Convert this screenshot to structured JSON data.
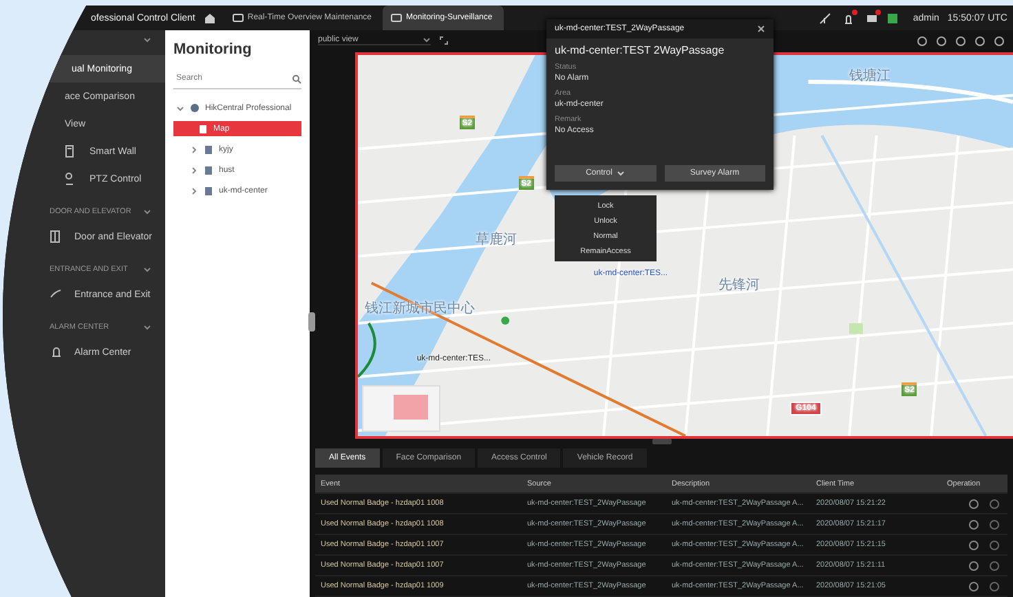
{
  "app": {
    "title": "ofessional Control Client"
  },
  "top_tabs": [
    {
      "label": "Real-Time Overview Maintenance",
      "selected": false
    },
    {
      "label": "Monitoring-Surveillance",
      "selected": true
    }
  ],
  "user": {
    "name": "admin",
    "time": "15:50:07 UTC"
  },
  "nav": [
    {
      "items": [
        {
          "label": "ual Monitoring",
          "selected": true
        },
        {
          "label": "ace Comparison",
          "selected": false
        },
        {
          "label": "View",
          "selected": false
        },
        {
          "label": "Smart Wall",
          "selected": false
        },
        {
          "label": "PTZ Control",
          "selected": false
        }
      ]
    },
    {
      "title": "DOOR AND ELEVATOR",
      "items": [
        {
          "label": "Door and Elevator",
          "selected": false
        }
      ]
    },
    {
      "title": "ENTRANCE AND EXIT",
      "items": [
        {
          "label": "Entrance and Exit",
          "selected": false
        }
      ]
    },
    {
      "title": "ALARM CENTER",
      "items": [
        {
          "label": "Alarm Center",
          "selected": false
        }
      ]
    }
  ],
  "tree": {
    "title": "Monitoring",
    "search": {
      "placeholder": "Search"
    },
    "root": {
      "label": "HikCentral Professional",
      "expanded": true,
      "children": [
        {
          "label": "Map",
          "selected": true
        },
        {
          "label": "kyjy",
          "selected": false,
          "expanded": false
        },
        {
          "label": "hust",
          "selected": false,
          "expanded": false
        },
        {
          "label": "uk-md-center",
          "selected": false,
          "expanded": false
        }
      ]
    }
  },
  "toolbar": {
    "view": "public view"
  },
  "map": {
    "labels": [
      {
        "kind": "place",
        "text": "钱塘江"
      },
      {
        "kind": "road",
        "text": "S2"
      },
      {
        "kind": "road",
        "text": "S2"
      },
      {
        "kind": "place",
        "text": "草鹿河"
      },
      {
        "kind": "marker",
        "text": "uk-md-center:TES..."
      },
      {
        "kind": "place",
        "text": "先锋河"
      },
      {
        "kind": "place",
        "text": "钱江新城市民中心"
      },
      {
        "kind": "pin",
        "text": "uk-md-center:TES..."
      },
      {
        "kind": "road",
        "text": "S2"
      },
      {
        "kind": "highway",
        "text": "G104"
      }
    ]
  },
  "popup": {
    "title": "uk-md-center:TEST_2WayPassage",
    "heading": "uk-md-center:TEST 2WayPassage",
    "fields": [
      {
        "label": "Status",
        "value": "No Alarm"
      },
      {
        "label": "Area",
        "value": "uk-md-center"
      },
      {
        "label": "Remark",
        "value": "No Access"
      }
    ],
    "control_button": "Control",
    "alarm_button": "Survey Alarm",
    "menu": [
      "Lock",
      "Unlock",
      "Normal",
      "RemainAccess"
    ]
  },
  "event_tabs": [
    {
      "label": "All Events",
      "selected": true
    },
    {
      "label": "Face Comparison",
      "selected": false
    },
    {
      "label": "Access Control",
      "selected": false
    },
    {
      "label": "Vehicle Record",
      "selected": false
    }
  ],
  "table": {
    "columns": [
      "Event",
      "Source",
      "Description",
      "Client Time",
      "Operation"
    ],
    "rows": [
      [
        "Used Normal Badge - hzdap01 1008",
        "uk-md-center:TEST_2WayPassage",
        "uk-md-center:TEST_2WayPassage A...",
        "2020/08/07 15:21:22"
      ],
      [
        "Used Normal Badge - hzdap01 1008",
        "uk-md-center:TEST_2WayPassage",
        "uk-md-center:TEST_2WayPassage A...",
        "2020/08/07 15:21:17"
      ],
      [
        "Used Normal Badge - hzdap01 1007",
        "uk-md-center:TEST_2WayPassage",
        "uk-md-center:TEST_2WayPassage A...",
        "2020/08/07 15:21:15"
      ],
      [
        "Used Normal Badge - hzdap01 1007",
        "uk-md-center:TEST_2WayPassage",
        "uk-md-center:TEST_2WayPassage A...",
        "2020/08/07 15:21:11"
      ],
      [
        "Used Normal Badge - hzdap01 1009",
        "uk-md-center:TEST_2WayPassage",
        "uk-md-center:TEST_2WayPassage A...",
        "2020/08/07 15:21:05"
      ]
    ]
  }
}
